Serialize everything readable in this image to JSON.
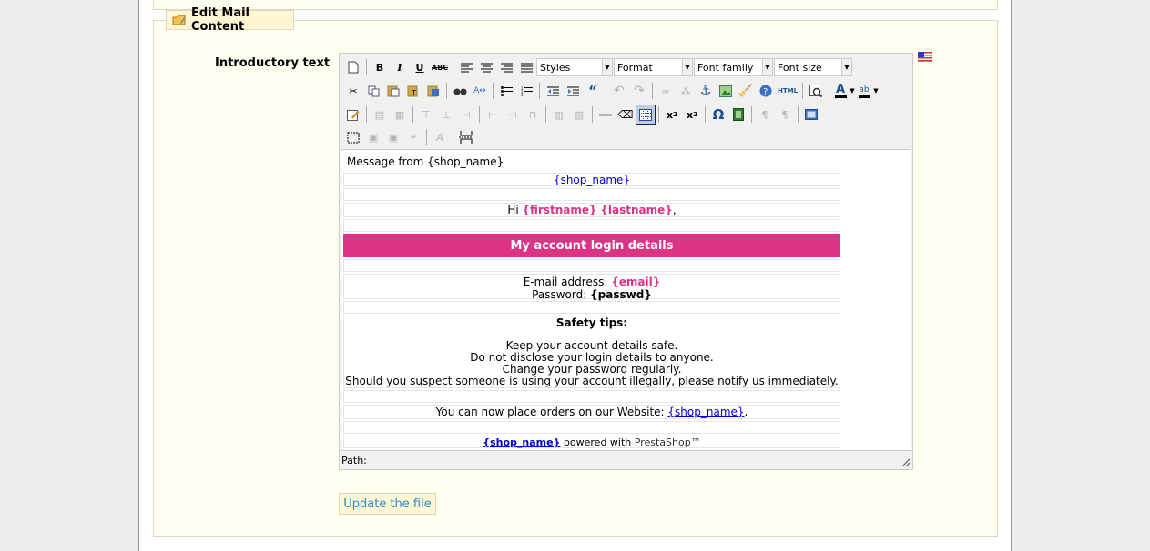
{
  "legend": {
    "title": "Edit Mail Content",
    "icon": "edit-folder-icon"
  },
  "field": {
    "label": "Introductory text",
    "language_flag": "us-flag-icon"
  },
  "toolbar": {
    "row1": {
      "styles": "Styles",
      "format": "Format",
      "font_family": "Font family",
      "font_size": "Font size"
    },
    "html_label": "HTML",
    "omega": "Ω"
  },
  "content": {
    "message_from": "Message from {shop_name}",
    "shop_name": "{shop_name}",
    "greeting_hi": "Hi ",
    "firstname": "{firstname}",
    "lastname": "{lastname}",
    "greeting_comma": ",",
    "banner": "My account login details",
    "email_label": "E-mail address: ",
    "email_value": "{email}",
    "password_label": "Password: ",
    "password_value": "{passwd}",
    "safety_title": "Safety tips:",
    "tips": [
      "Keep your account details safe.",
      "Do not disclose your login details to anyone.",
      "Change your password regularly.",
      "Should you suspect someone is using your account illegally, please notify us immediately."
    ],
    "orders_text": "You can now place orders on our Website: ",
    "orders_end": ".",
    "footer_shop": "{shop_name}",
    "footer_powered": " powered with ",
    "footer_brand": "PrestaShop™"
  },
  "path_label": "Path:",
  "update_button": "Update the file",
  "colors": {
    "accent_pink": "#db3484",
    "link_blue": "#268ccd",
    "fieldset_bg": "#fffff0"
  }
}
